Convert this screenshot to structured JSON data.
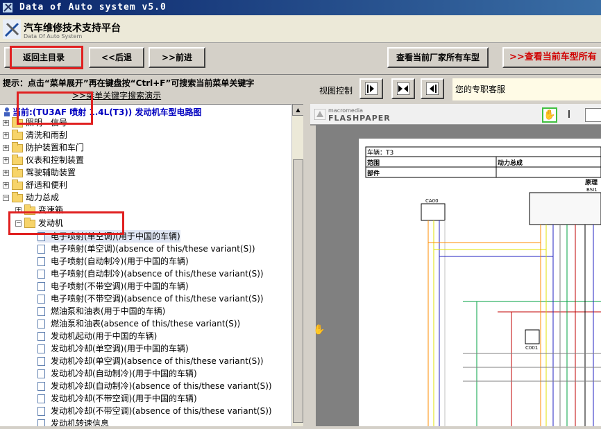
{
  "window": {
    "title": "Data of Auto system v5.0"
  },
  "banner": {
    "title": "汽车维修技术支持平台",
    "subtitle": "Data Of Auto System"
  },
  "toolbar": {
    "home_label": "返回主目录",
    "back_label": "<<后退",
    "forward_label": ">>前进",
    "all_models_label": "查看当前厂家所有车型",
    "current_models_label": ">>查看当前车型所有"
  },
  "hint": {
    "text": "提示：点击“菜单展开”再在键盘按“Ctrl+F”可搜索当前菜单关键字",
    "link": ">>菜单关键字搜索演示"
  },
  "view_control": {
    "label": "视图控制"
  },
  "service": {
    "text": "您的专职客服"
  },
  "tree": {
    "title": "当前:(TU3AF 喷射 1.4L(T3)) 发动机车型电路图",
    "categories": [
      "照明—信号",
      "清洗和雨刮",
      "防护装置和车门",
      "仪表和控制装置",
      "驾驶辅助装置",
      "舒适和便利",
      "动力总成"
    ],
    "sub_folders": [
      "变速箱",
      "发动机"
    ],
    "documents": [
      "电子喷射(单空调)(用于中国的车辆)",
      "电子喷射(单空调)(absence of this/these variant(S))",
      "电子喷射(自动制冷)(用于中国的车辆)",
      "电子喷射(自动制冷)(absence of this/these variant(S))",
      "电子喷射(不带空调)(用于中国的车辆)",
      "电子喷射(不带空调)(absence of this/these variant(S))",
      "燃油泵和油表(用于中国的车辆)",
      "燃油泵和油表(absence of this/these variant(S))",
      "发动机起动(用于中国的车辆)",
      "发动机冷却(单空调)(用于中国的车辆)",
      "发动机冷却(单空调)(absence of this/these variant(S))",
      "发动机冷却(自动制冷)(用于中国的车辆)",
      "发动机冷却(自动制冷)(absence of this/these variant(S))",
      "发动机冷却(不带空调)(用于中国的车辆)",
      "发动机冷却(不带空调)(absence of this/these variant(S))",
      "发动机转速信息"
    ]
  },
  "viewer": {
    "brand_small": "macromedia",
    "brand_large": "FLASHPAPER",
    "doc": {
      "vehicle_label": "车辆：T3",
      "scope_label": "范围",
      "scope_value": "动力总成",
      "part_label": "部件",
      "principle": "原理",
      "conn_ca00": "CA00",
      "conn_bsi1": "BSI1",
      "conn_c001": "C001"
    }
  },
  "colors": {
    "highlight_box": "#e02020",
    "title_blue": "#0000c0"
  }
}
